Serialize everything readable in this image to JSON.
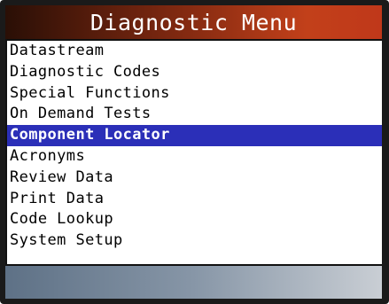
{
  "header": {
    "title": "Diagnostic Menu"
  },
  "menu": {
    "items": [
      {
        "label": "Datastream"
      },
      {
        "label": "Diagnostic Codes"
      },
      {
        "label": "Special Functions"
      },
      {
        "label": "On Demand Tests"
      },
      {
        "label": "Component Locator"
      },
      {
        "label": "Acronyms"
      },
      {
        "label": "Review Data"
      },
      {
        "label": "Print Data"
      },
      {
        "label": "Code Lookup"
      },
      {
        "label": "System Setup"
      }
    ],
    "selected": "Component Locator"
  },
  "colors": {
    "selection": "#2b2fb8",
    "title_gradient_dark": "#2a0f06",
    "title_gradient_light": "#c2401a",
    "bottom_gradient_left": "#5e7186",
    "bottom_gradient_right": "#c9ced4"
  }
}
